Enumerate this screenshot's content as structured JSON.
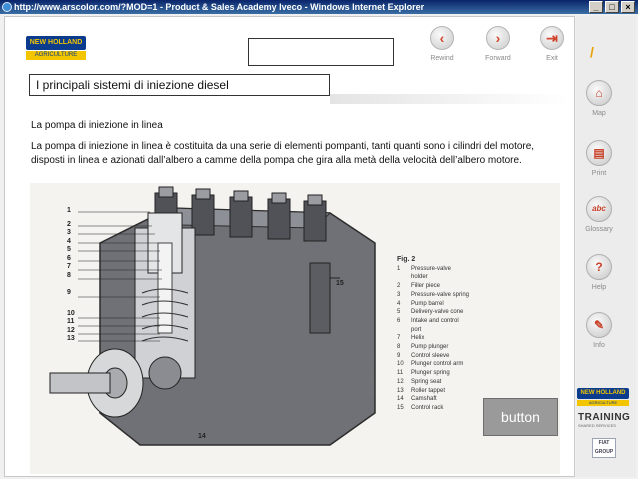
{
  "window": {
    "title": "http://www.arscolor.com/?MOD=1 - Product & Sales Academy Iveco - Windows Internet Explorer",
    "controls": [
      "_",
      "□",
      "×"
    ]
  },
  "header": {
    "logo_top": "NEW HOLLAND",
    "logo_bottom": "AGRICULTURE",
    "nav": [
      {
        "label": "Rewind",
        "icon": "rewind-icon"
      },
      {
        "label": "Forward",
        "icon": "forward-icon"
      },
      {
        "label": "Exit",
        "icon": "exit-icon"
      }
    ]
  },
  "page": {
    "title": "I principali sistemi di iniezione diesel",
    "subheading": "La pompa di iniezione in linea",
    "paragraph": "La pompa di iniezione in linea è costituita da una serie di elementi pompanti, tanti quanti sono i cilindri del motore, disposti in linea e azionati dall’albero a camme della pompa che gira alla metà della velocità dell’albero motore."
  },
  "figure": {
    "heading": "Fig. 2",
    "callouts_left": [
      "1",
      "2",
      "3",
      "4",
      "5",
      "6",
      "7",
      "8",
      "9",
      "10",
      "11",
      "12",
      "13"
    ],
    "callouts_other": [
      "15",
      "14"
    ],
    "legend": [
      {
        "num": "1",
        "text": "Pressure-valve"
      },
      {
        "num": "",
        "text": "holder"
      },
      {
        "num": "2",
        "text": "Filler piece"
      },
      {
        "num": "3",
        "text": "Pressure-valve spring"
      },
      {
        "num": "4",
        "text": "Pump barrel"
      },
      {
        "num": "5",
        "text": "Delivery-valve cone"
      },
      {
        "num": "6",
        "text": "Intake and control"
      },
      {
        "num": "",
        "text": "port"
      },
      {
        "num": "7",
        "text": "Helix"
      },
      {
        "num": "8",
        "text": "Pump plunger"
      },
      {
        "num": "9",
        "text": "Control sleeve"
      },
      {
        "num": "10",
        "text": "Plunger control arm"
      },
      {
        "num": "11",
        "text": "Plunger spring"
      },
      {
        "num": "12",
        "text": "Spring seat"
      },
      {
        "num": "13",
        "text": "Roller tappet"
      },
      {
        "num": "14",
        "text": "Camshaft"
      },
      {
        "num": "15",
        "text": "Control rack"
      }
    ],
    "vertical_code": "© UMK0409-1Y"
  },
  "button": {
    "label": "button"
  },
  "sidebar": {
    "items": [
      {
        "label": "Map",
        "icon": "map-icon"
      },
      {
        "label": "Print",
        "icon": "print-icon"
      },
      {
        "label": "Glossary",
        "icon": "glossary-icon"
      },
      {
        "label": "Help",
        "icon": "help-icon"
      },
      {
        "label": "Info",
        "icon": "info-icon"
      }
    ],
    "brand_top": "NEW HOLLAND",
    "brand_bottom": "AGRICULTURE",
    "training": "TRAINING",
    "training_sub": "SHARED SERVICES",
    "fiat_1": "FIAT",
    "fiat_2": "GROUP"
  },
  "colors": {
    "accent": "#c8422a",
    "brand_blue": "#0b3b8c",
    "brand_yellow": "#f2c500",
    "button_bg": "#9a9a9a"
  }
}
